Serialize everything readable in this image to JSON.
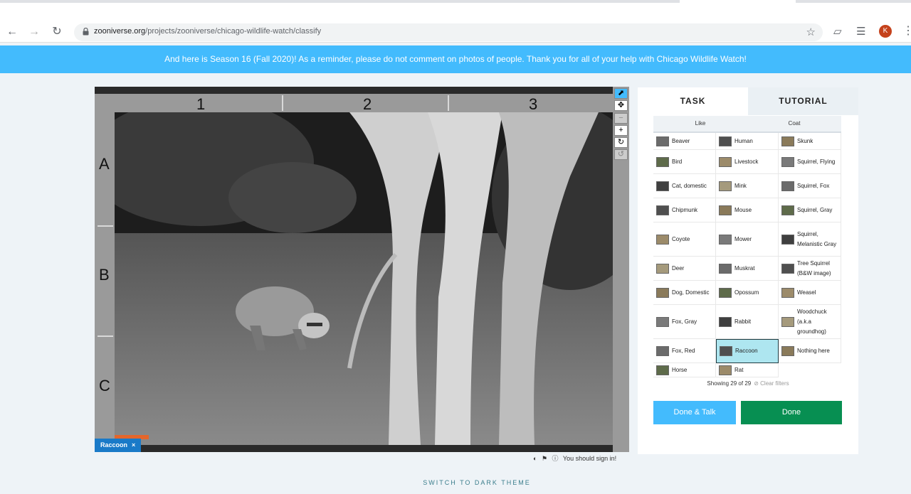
{
  "browser": {
    "url_host": "zooniverse.org",
    "url_path": "/projects/zooniverse/chicago-wildlife-watch/classify",
    "profile_initial": "K"
  },
  "banner": {
    "text": "And here is Season 16 (Fall 2020)! As a reminder, please do not comment on photos of people. Thank you for all of your help with Chicago Wildlife Watch!"
  },
  "viewer": {
    "grid_columns": [
      "1",
      "2",
      "3"
    ],
    "grid_rows": [
      "A",
      "B",
      "C"
    ],
    "mark_label": "Raccoon",
    "mark_remove": "×",
    "sign_in_text": "You should sign in!"
  },
  "panel": {
    "tabs": {
      "task": "TASK",
      "tutorial": "TUTORIAL"
    },
    "filters": {
      "like": "Like",
      "coat": "Coat"
    },
    "choices": [
      [
        "Beaver",
        "Human",
        "Skunk"
      ],
      [
        "Bird",
        "Livestock",
        "Squirrel, Flying"
      ],
      [
        "Cat, domestic",
        "Mink",
        "Squirrel, Fox"
      ],
      [
        "Chipmunk",
        "Mouse",
        "Squirrel, Gray"
      ],
      [
        "Coyote",
        "Mower",
        "Squirrel, Melanistic Gray"
      ],
      [
        "Deer",
        "Muskrat",
        "Tree Squirrel (B&W image)"
      ],
      [
        "Dog, Domestic",
        "Opossum",
        "Weasel"
      ],
      [
        "Fox, Gray",
        "Rabbit",
        "Woodchuck (a.k.a groundhog)"
      ],
      [
        "Fox, Red",
        "Raccoon",
        "Nothing here"
      ],
      [
        "Horse",
        "Rat",
        ""
      ]
    ],
    "selected_choice": "Raccoon",
    "showing_text": "Showing 29 of 29",
    "clear_filters": "Clear filters",
    "done_talk_label": "Done & Talk",
    "done_label": "Done"
  },
  "footer": {
    "dark_theme_label": "SWITCH TO DARK THEME"
  },
  "colors": {
    "banner": "#43bbfd",
    "done": "#078f52",
    "done_talk": "#43bbfd",
    "selected": "#aee6f0"
  }
}
